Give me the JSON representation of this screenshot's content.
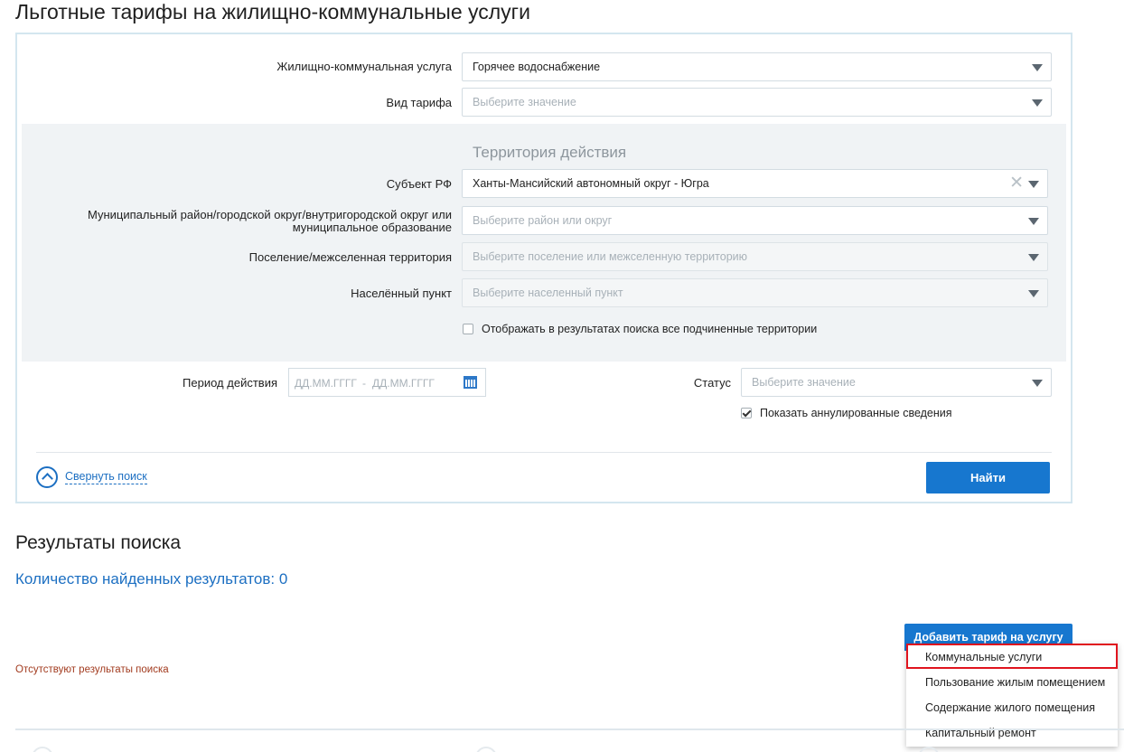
{
  "page": {
    "title": "Льготные тарифы на жилищно-коммунальные услуги"
  },
  "form": {
    "service": {
      "label": "Жилищно-коммунальная услуга",
      "value": "Горячее водоснабжение"
    },
    "tariff_type": {
      "label": "Вид тарифа",
      "placeholder": "Выберите значение"
    },
    "territory": {
      "title": "Территория действия",
      "subject": {
        "label": "Субъект РФ",
        "value": "Ханты-Мансийский автономный округ - Югра"
      },
      "district": {
        "label": "Муниципальный район/городской округ/внутригородской округ или муниципальное образование",
        "placeholder": "Выберите район или округ"
      },
      "settlement": {
        "label": "Поселение/межселенная территория",
        "placeholder": "Выберите поселение или межселенную территорию"
      },
      "locality": {
        "label": "Населённый пункт",
        "placeholder": "Выберите населенный пункт"
      },
      "show_subordinate": {
        "label": "Отображать в результатах поиска все подчиненные территории",
        "checked": false
      }
    },
    "period": {
      "label": "Период действия",
      "from_placeholder": "ДД.ММ.ГГГГ",
      "separator": "-",
      "to_placeholder": "ДД.ММ.ГГГГ"
    },
    "status": {
      "label": "Статус",
      "placeholder": "Выберите значение"
    },
    "show_annulled": {
      "label": "Показать аннулированные сведения",
      "checked": true
    },
    "collapse_label": "Свернуть поиск",
    "find_label": "Найти"
  },
  "results": {
    "title": "Результаты поиска",
    "count": "Количество найденных результатов: 0",
    "empty": "Отсутствуют результаты поиска",
    "add_button": "Добавить тариф на услугу",
    "add_menu": [
      "Коммунальные услуги",
      "Пользование жилым помещением",
      "Содержание жилого помещения",
      "Капитальный ремонт"
    ]
  },
  "colors": {
    "accent": "#1777cf",
    "highlight_border": "#e0141e",
    "empty_text": "#a23b1f"
  },
  "icons": {
    "calendar": "calendar-icon",
    "collapse": "chevron-up-circle-icon",
    "clear": "close-icon",
    "caret": "caret-down-icon"
  }
}
